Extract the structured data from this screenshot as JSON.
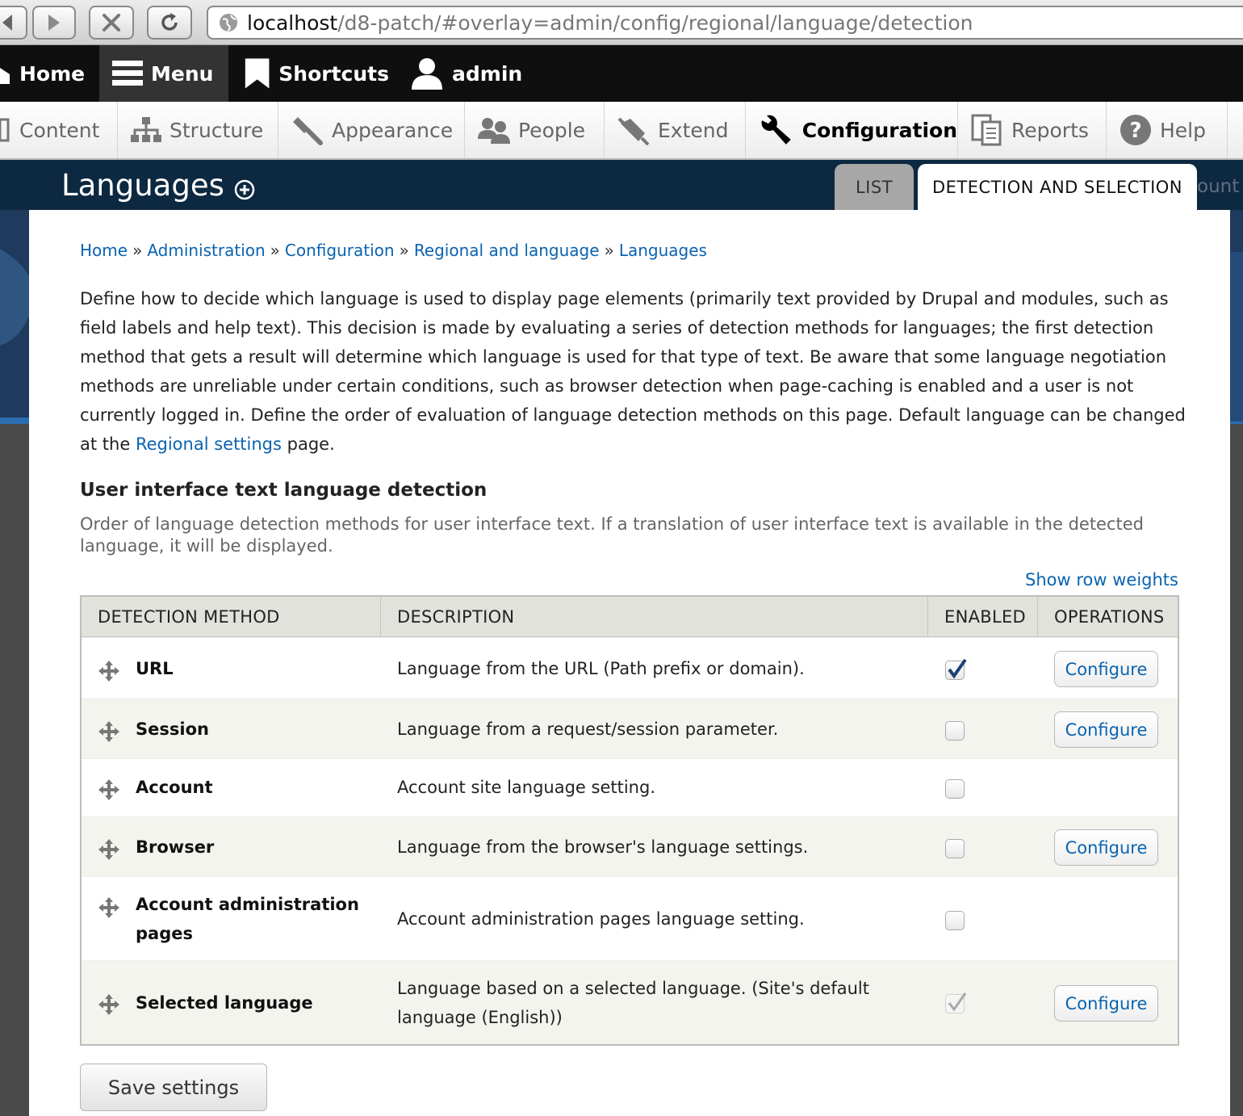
{
  "browser": {
    "url_host": "localhost",
    "url_path": "/d8-patch/#overlay=admin/config/regional/language/detection"
  },
  "toolbar": {
    "items": [
      {
        "label": "Home",
        "icon": "house-icon"
      },
      {
        "label": "Menu",
        "icon": "hamburger-icon"
      },
      {
        "label": "Shortcuts",
        "icon": "star-icon"
      },
      {
        "label": "admin",
        "icon": "user-icon"
      }
    ]
  },
  "admin_tray": {
    "items": [
      {
        "label": "Content",
        "icon": "page-icon"
      },
      {
        "label": "Structure",
        "icon": "sitemap-icon"
      },
      {
        "label": "Appearance",
        "icon": "paintbrush-icon"
      },
      {
        "label": "People",
        "icon": "people-icon"
      },
      {
        "label": "Extend",
        "icon": "puzzle-icon"
      },
      {
        "label": "Configuration",
        "icon": "wrench-icon"
      },
      {
        "label": "Reports",
        "icon": "report-icon"
      },
      {
        "label": "Help",
        "icon": "question-icon"
      }
    ],
    "active": "Configuration"
  },
  "overlay": {
    "title": "Languages",
    "tabs": [
      {
        "label": "LIST"
      },
      {
        "label": "DETECTION AND SELECTION"
      }
    ],
    "behind_text": "ount"
  },
  "breadcrumb": {
    "items": [
      "Home",
      "Administration",
      "Configuration",
      "Regional and language",
      "Languages"
    ],
    "separator": "»"
  },
  "intro": {
    "text": "Define how to decide which language is used to display page elements (primarily text provided by Drupal and modules, such as field labels and help text). This decision is made by evaluating a series of detection methods for languages; the first detection method that gets a result will determine which language is used for that type of text. Be aware that some language negotiation methods are unreliable under certain conditions, such as browser detection when page-caching is enabled and a user is not currently logged in. Define the order of evaluation of language detection methods on this page. Default language can be changed at the",
    "link": "Regional settings",
    "after": "page."
  },
  "section": {
    "title": "User interface text language detection",
    "description": "Order of language detection methods for user interface text. If a translation of user interface text is available in the detected language, it will be displayed.",
    "show_weights": "Show row weights"
  },
  "table": {
    "headers": [
      "DETECTION METHOD",
      "DESCRIPTION",
      "ENABLED",
      "OPERATIONS"
    ],
    "rows": [
      {
        "method": "URL",
        "description": "Language from the URL (Path prefix or domain).",
        "enabled": true,
        "configure": "Configure"
      },
      {
        "method": "Session",
        "description": "Language from a request/session parameter.",
        "enabled": false,
        "configure": "Configure"
      },
      {
        "method": "Account",
        "description": "Account site language setting.",
        "enabled": false,
        "configure": ""
      },
      {
        "method": "Browser",
        "description": "Language from the browser's language settings.",
        "enabled": false,
        "configure": "Configure"
      },
      {
        "method": "Account administration pages",
        "description": "Account administration pages language setting.",
        "enabled": false,
        "configure": ""
      },
      {
        "method": "Selected language",
        "description": "Language based on a selected language. (Site's default language (English))",
        "enabled": true,
        "disabled": true,
        "configure": "Configure"
      }
    ]
  },
  "save_button": "Save settings",
  "colors": {
    "link": "#0a63b0",
    "toolbar_bg": "#0f0f0f",
    "overlay_header": "#0d2841"
  }
}
